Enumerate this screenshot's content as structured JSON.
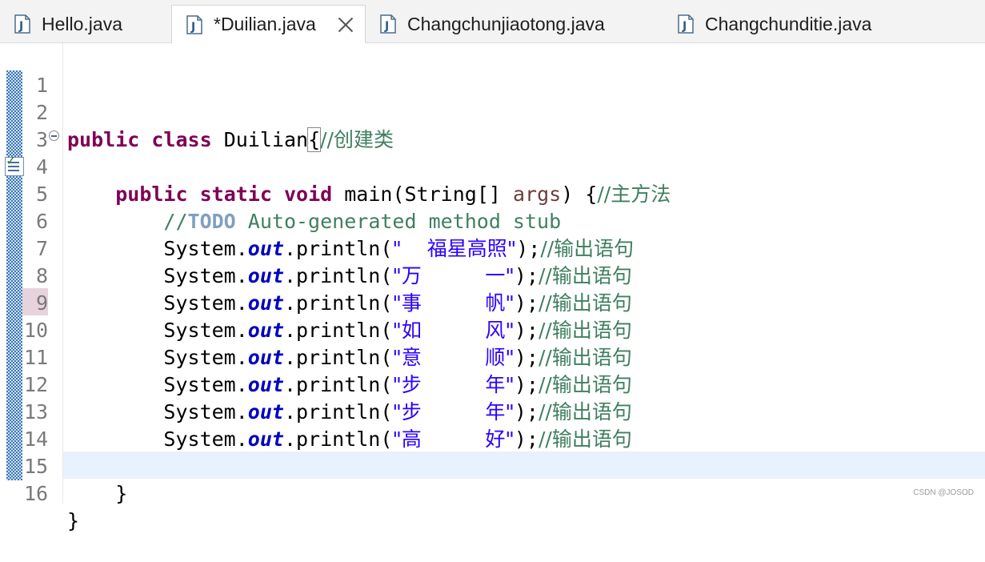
{
  "tabs": [
    {
      "label": "Hello.java",
      "active": false
    },
    {
      "label": "*Duilian.java",
      "active": true
    },
    {
      "label": "Changchunjiaotong.java",
      "active": false
    },
    {
      "label": "Changchunditie.java",
      "active": false
    }
  ],
  "line_numbers": [
    "1",
    "2",
    "3",
    "4",
    "5",
    "6",
    "7",
    "8",
    "9",
    "10",
    "11",
    "12",
    "13",
    "14",
    "15",
    "16"
  ],
  "code": {
    "l2": {
      "kw1": "public",
      "kw2": "class",
      "name": "Duilian",
      "brace": "{",
      "comment": "//创建类"
    },
    "l4": {
      "indent": "    ",
      "kw1": "public",
      "kw2": "static",
      "kw3": "void",
      "sig": "main(String[] ",
      "param": "args",
      "tail": ") {",
      "comment": "//主方法"
    },
    "l5": {
      "indent": "        ",
      "comment_prefix": "//",
      "todo": "TODO",
      "comment_rest": " Auto-generated method stub"
    },
    "println_lines": [
      {
        "string": "\"    福星高照\"",
        "comment": "//输出语句"
      },
      {
        "string": "\"万          一\"",
        "comment": "//输出语句"
      },
      {
        "string": "\"事          帆\"",
        "comment": "//输出语句"
      },
      {
        "string": "\"如          风\"",
        "comment": "//输出语句"
      },
      {
        "string": "\"意          顺\"",
        "comment": "//输出语句"
      },
      {
        "string": "\"步          年\"",
        "comment": "//输出语句"
      },
      {
        "string": "\"步          年\"",
        "comment": "//输出语句"
      },
      {
        "string": "\"高          好\"",
        "comment": "//输出语句"
      }
    ],
    "println_parts": {
      "indent": "        ",
      "obj": "System.",
      "field": "out",
      "method": ".println(",
      "close": ");"
    },
    "l15": {
      "text": "    }"
    },
    "l16": {
      "text": "}"
    }
  },
  "watermark": "CSDN @JOSOD",
  "colors": {
    "keyword": "#7f0055",
    "comment": "#3f7f5f",
    "string": "#2a00ff",
    "static_field": "#0000c0",
    "current_line": "#e8f2fe"
  },
  "icons": [
    "java-file-icon",
    "close-icon",
    "fold-collapse-icon",
    "task-marker-icon"
  ]
}
